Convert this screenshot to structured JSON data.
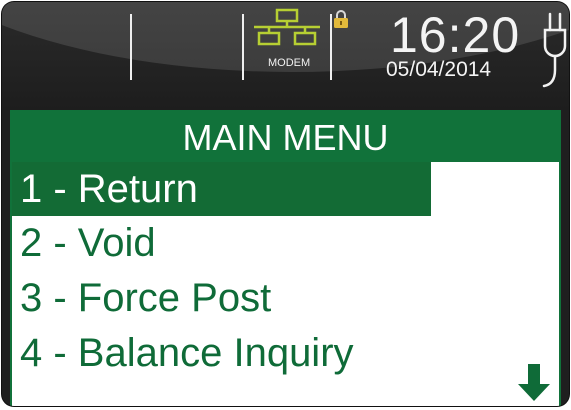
{
  "status_bar": {
    "connection_label": "MODEM",
    "connection_icon": "network-icon",
    "lock_icon": "lock-icon",
    "time": "16:20",
    "date": "05/04/2014",
    "power_icon": "plug-icon"
  },
  "menu": {
    "title": "MAIN MENU",
    "items": [
      {
        "label": "1 - Return",
        "selected": true
      },
      {
        "label": "2 - Void",
        "selected": false
      },
      {
        "label": "3 - Force Post",
        "selected": false
      },
      {
        "label": "4 - Balance Inquiry",
        "selected": false
      }
    ],
    "scroll_icon": "down-arrow-icon"
  },
  "colors": {
    "accent_green": "#11723a",
    "icon_yellow_green": "#b7cf33",
    "lock_gold": "#e2b93b",
    "header_dark": "#1f1f1f"
  }
}
